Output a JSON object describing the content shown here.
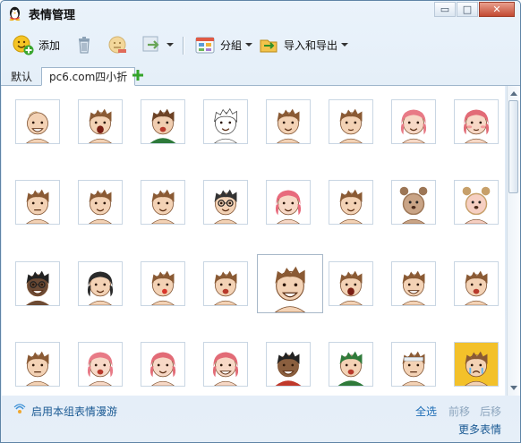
{
  "window": {
    "title": "表情管理",
    "controls": {
      "minimize": "▭",
      "maximize": "□",
      "close": "✕"
    }
  },
  "toolbar": {
    "add_label": "添加",
    "group_label": "分組",
    "import_export_label": "导入和导出"
  },
  "tabs": [
    {
      "label": "默认",
      "active": false
    },
    {
      "label": "pc6.com四小折",
      "active": true
    }
  ],
  "emoticons": [
    {
      "hair": "#b98a58",
      "skin": "#f3d2b5",
      "mouth": "grin",
      "extra": "bald"
    },
    {
      "hair": "#8a5a34",
      "skin": "#f3d2b5",
      "mouth": "scream"
    },
    {
      "hair": "#6d4225",
      "skin": "#f0cdb0",
      "mouth": "open",
      "shirt": "#2d7a3a"
    },
    {
      "hair": "#ffffff",
      "skin": "#ffffff",
      "mouth": "smile",
      "outline": true
    },
    {
      "hair": "#8a5a34",
      "skin": "#f3d2b5",
      "mouth": "smile"
    },
    {
      "hair": "#8a5a34",
      "skin": "#f3d2b5",
      "mouth": "dizzy"
    },
    {
      "hair": "#e87a86",
      "skin": "#f7d8c6",
      "mouth": "smile",
      "girl": true
    },
    {
      "hair": "#e26b76",
      "skin": "#f7d8c6",
      "mouth": "shy",
      "girl": true
    },
    {
      "hair": "#8a5a34",
      "skin": "#f3d2b5",
      "mouth": "line"
    },
    {
      "hair": "#8a5a34",
      "skin": "#f3d2b5",
      "mouth": "smile"
    },
    {
      "hair": "#8a5a34",
      "skin": "#f3d2b5",
      "mouth": "smile"
    },
    {
      "hair": "#333333",
      "skin": "#f3d2b5",
      "mouth": "smile",
      "glasses": true
    },
    {
      "hair": "#e86a7c",
      "skin": "#f7d8c6",
      "mouth": "smile",
      "girl": true
    },
    {
      "hair": "#8a5a34",
      "skin": "#f3d2b5",
      "mouth": "smile"
    },
    {
      "hair": "#9c7656",
      "skin": "#c9a486",
      "mouth": "line",
      "animal": true
    },
    {
      "hair": "#c7a06a",
      "skin": "#f6cfc2",
      "mouth": "smile",
      "animal": true
    },
    {
      "hair": "#222222",
      "skin": "#6b4a35",
      "mouth": "grin",
      "glasses": true
    },
    {
      "hair": "#2a2a2a",
      "skin": "#f3d2b5",
      "mouth": "smile",
      "girl": true
    },
    {
      "hair": "#8a5a34",
      "skin": "#f3d2b5",
      "mouth": "blow"
    },
    {
      "hair": "#8a5a34",
      "skin": "#f3d2b5",
      "mouth": "open"
    },
    {
      "hair": "#8a5a34",
      "skin": "#f3d2b5",
      "mouth": "grin",
      "big": true
    },
    {
      "hair": "#8a5a34",
      "skin": "#f3d2b5",
      "mouth": "scream"
    },
    {
      "hair": "#8a5a34",
      "skin": "#f3d2b5",
      "mouth": "grin"
    },
    {
      "hair": "#8a5a34",
      "skin": "#f3d2b5",
      "mouth": "open"
    },
    {
      "hair": "#8a5a34",
      "skin": "#f3d2b5",
      "mouth": "line"
    },
    {
      "hair": "#e87a86",
      "skin": "#f7d8c6",
      "mouth": "open",
      "girl": true
    },
    {
      "hair": "#e26b76",
      "skin": "#f7d8c6",
      "mouth": "smile",
      "girl": true
    },
    {
      "hair": "#e26b76",
      "skin": "#f7d8c6",
      "mouth": "grin",
      "girl": true
    },
    {
      "hair": "#222222",
      "skin": "#8a5f3f",
      "mouth": "grin",
      "shirt": "#c0392b"
    },
    {
      "hair": "#2f7a3a",
      "skin": "#f3d2b5",
      "mouth": "open",
      "shirt": "#2f7a3a"
    },
    {
      "hair": "#8a5a34",
      "skin": "#f3d2b5",
      "mouth": "line",
      "bandage": true
    },
    {
      "hair": "#8a5a34",
      "skin": "#f3d2b5",
      "mouth": "cry",
      "bg": "#f3c12a"
    }
  ],
  "footer": {
    "roaming_label": "启用本组表情漫游",
    "select_all": "全选",
    "move_prev": "前移",
    "move_next": "后移",
    "more_emoticons": "更多表情"
  },
  "colors": {
    "window_bg": "#e3edf7",
    "border": "#5f84a6",
    "link": "#1b5a94",
    "disabled_link": "#8ea6bf"
  }
}
